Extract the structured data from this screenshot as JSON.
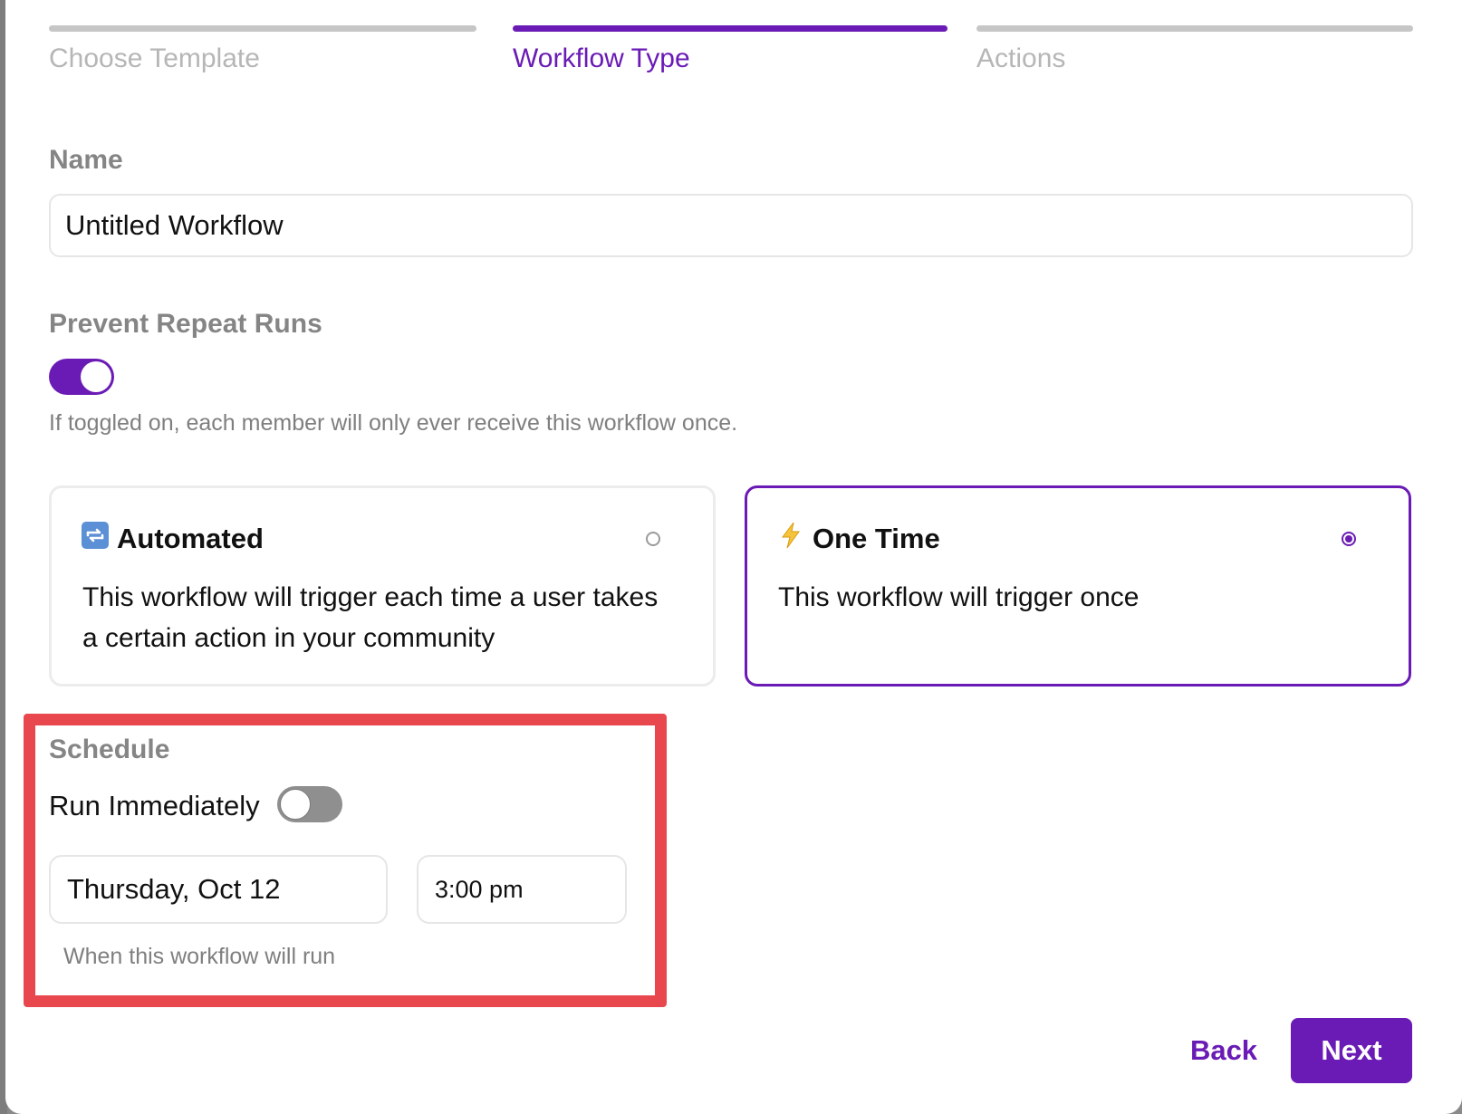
{
  "stepper": {
    "steps": [
      {
        "label": "Choose Template",
        "active": false
      },
      {
        "label": "Workflow Type",
        "active": true
      },
      {
        "label": "Actions",
        "active": false
      }
    ]
  },
  "name_field": {
    "label": "Name",
    "value": "Untitled Workflow"
  },
  "prevent_repeat": {
    "label": "Prevent Repeat Runs",
    "enabled": true,
    "help": "If toggled on, each member will only ever receive this workflow once."
  },
  "workflow_types": [
    {
      "icon": "repeat-icon",
      "title": "Automated",
      "description": "This workflow will trigger each time a user takes a certain action in your community",
      "selected": false
    },
    {
      "icon": "lightning-icon",
      "title": "One Time",
      "description": "This workflow will trigger once",
      "selected": true
    }
  ],
  "schedule": {
    "label": "Schedule",
    "run_immediately_label": "Run Immediately",
    "run_immediately": false,
    "date": "Thursday, Oct 12",
    "time": "3:00 pm",
    "help": "When this workflow will run"
  },
  "footer": {
    "back_label": "Back",
    "next_label": "Next"
  },
  "colors": {
    "accent": "#6a1bb5",
    "highlight": "#e8484d"
  }
}
